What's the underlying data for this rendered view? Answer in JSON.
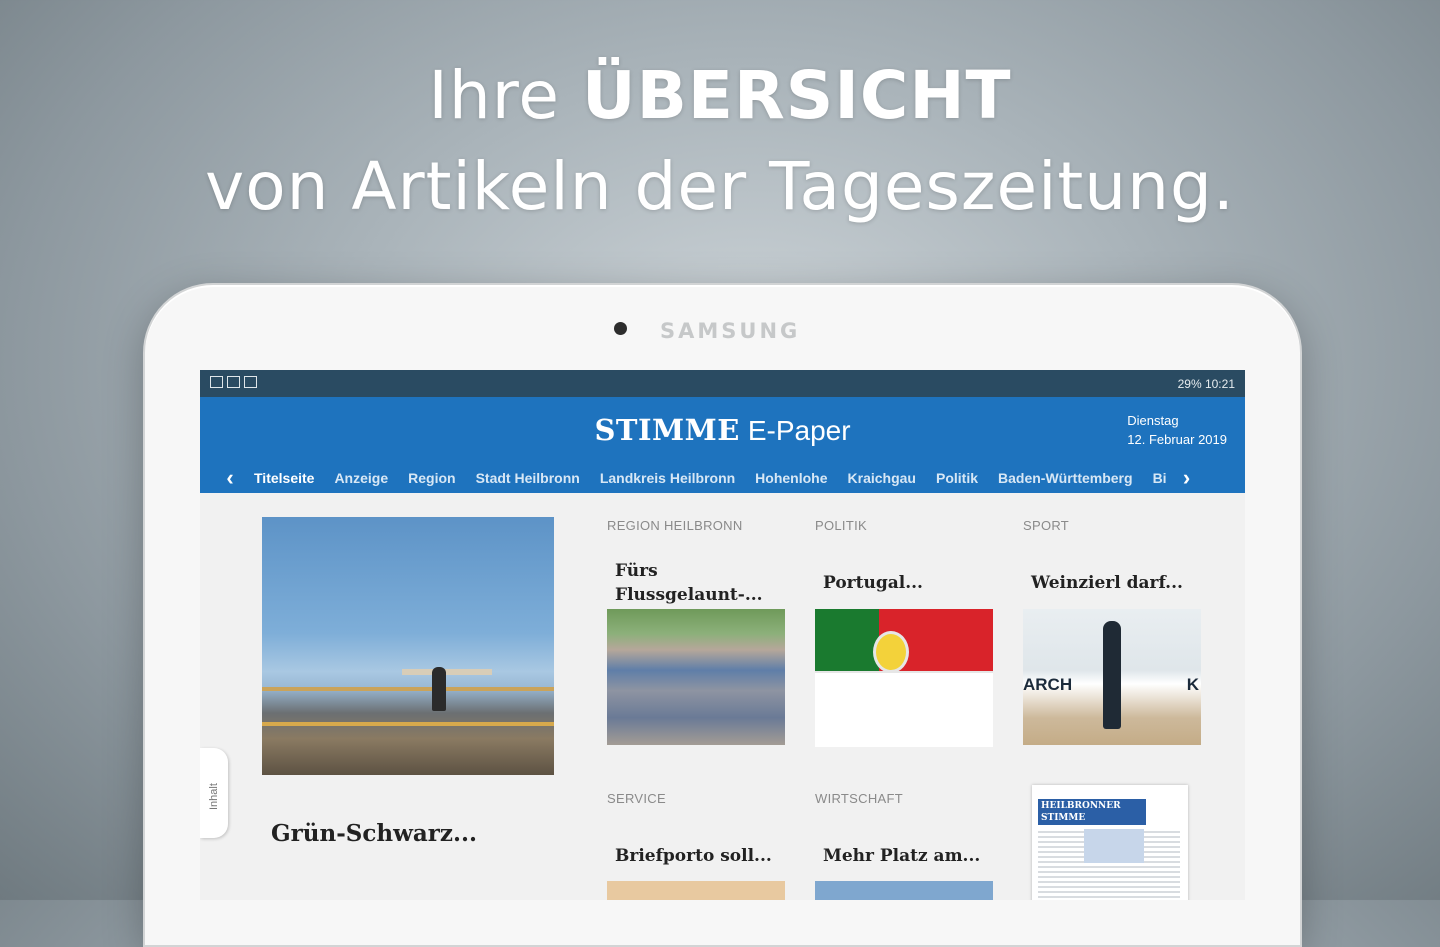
{
  "headline": {
    "line1_prefix": "Ihre",
    "line1_bold": "ÜBERSICHT",
    "line2": "von Artikeln der Tageszeitung."
  },
  "device": {
    "brand": "SAMSUNG"
  },
  "statusbar": {
    "right": "29% 10:21"
  },
  "app": {
    "logo_main": "STIMME",
    "logo_sub": "E-Paper",
    "date_weekday": "Dienstag",
    "date_full": "12. Februar 2019",
    "tabs": [
      "Titelseite",
      "Anzeige",
      "Region",
      "Stadt Heilbronn",
      "Landkreis Heilbronn",
      "Hohenlohe",
      "Kraichgau",
      "Politik",
      "Baden-Württemberg",
      "Bi"
    ],
    "active_tab": "Titelseite",
    "side_tab": "Inhalt",
    "accent_color": "#1e73be"
  },
  "lead": {
    "title": "Grün-Schwarz..."
  },
  "cards": [
    {
      "section": "REGION HEILBRONN",
      "title": "Fürs Flussgelaunt-..."
    },
    {
      "section": "POLITIK",
      "title": "Portugal..."
    },
    {
      "section": "SPORT",
      "title": "Weinzierl darf..."
    },
    {
      "section": "SERVICE",
      "title": "Briefporto soll..."
    },
    {
      "section": "WIRTSCHAFT",
      "title": "Mehr Platz am..."
    }
  ],
  "newspaper_thumb": {
    "masthead": "HEILBRONNER STIMME"
  }
}
